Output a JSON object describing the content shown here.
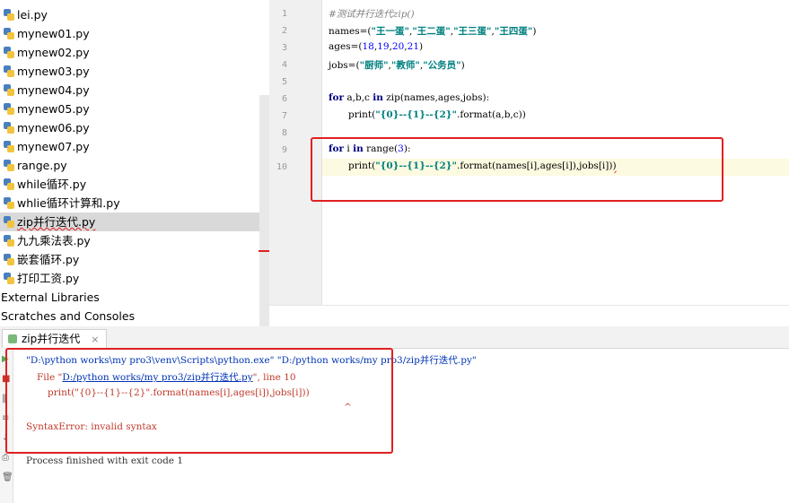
{
  "project_tree": {
    "files": [
      {
        "name": "lei.py"
      },
      {
        "name": "mynew01.py"
      },
      {
        "name": "mynew02.py"
      },
      {
        "name": "mynew03.py"
      },
      {
        "name": "mynew04.py"
      },
      {
        "name": "mynew05.py"
      },
      {
        "name": "mynew06.py"
      },
      {
        "name": "mynew07.py"
      },
      {
        "name": "range.py"
      },
      {
        "name": "while循环.py"
      },
      {
        "name": "whlie循环计算和.py"
      },
      {
        "name": "zip并行迭代.py"
      },
      {
        "name": "九九乘法表.py"
      },
      {
        "name": "嵌套循环.py"
      },
      {
        "name": "打印工资.py"
      }
    ],
    "selected_file": "zip并行迭代.py",
    "external_libraries": "External Libraries",
    "scratches": "Scratches and Consoles"
  },
  "editor": {
    "line_numbers": [
      "1",
      "2",
      "3",
      "4",
      "5",
      "6",
      "7",
      "8",
      "9",
      "10"
    ],
    "line1_comment": "#测试并行迭代zip()",
    "line2": {
      "name": "names=(",
      "s1": "\"王一蛋\"",
      "s2": "\"王二蛋\"",
      "s3": "\"王三蛋\"",
      "s4": "\"王四蛋\"",
      "end": ")"
    },
    "line3": {
      "pre": "ages=(",
      "n1": "18",
      "n2": "19",
      "n3": "20",
      "n4": "21",
      "end": ")"
    },
    "line4": {
      "pre": "jobs=(",
      "s1": "\"厨师\"",
      "s2": "\"教师\"",
      "s3": "\"公务员\"",
      "end": ")"
    },
    "line6": {
      "kw1": "for",
      "vars": " a,b,c ",
      "kw2": "in",
      "rest": " zip(names,ages,jobs):"
    },
    "line7": {
      "pre": "print(",
      "s": "\"{0}--{1}--{2}\"",
      "rest": ".format(a,b,c))"
    },
    "line9": {
      "kw1": "for",
      "var": " i ",
      "kw2": "in",
      "pre": " range(",
      "n": "3",
      "end": "):"
    },
    "line10": {
      "pre": "print(",
      "s": "\"{0}--{1}--{2}\"",
      "rest": ".format(names[i],ages[i]),jobs[i])",
      "err": ")"
    }
  },
  "run_panel": {
    "tab_label": "zip并行迭代",
    "tab_close": "×",
    "cmd_line": "\"D:\\python works\\my pro3\\venv\\Scripts\\python.exe\" \"D:/python works/my pro3/zip并行迭代.py\"",
    "file_prefix": "File \"",
    "file_link": "D:/python works/my pro3/zip并行迭代.py",
    "file_suffix": "\", line 10",
    "code_echo": "print(\"{0}--{1}--{2}\".format(names[i],ages[i]),jobs[i]))",
    "caret": "^",
    "error": "SyntaxError: invalid syntax",
    "exit_msg": "Process finished with exit code 1"
  },
  "colors": {
    "annotation_box": "#e02020",
    "selection": "#d9d9d9",
    "current_line": "#fcfae0"
  }
}
